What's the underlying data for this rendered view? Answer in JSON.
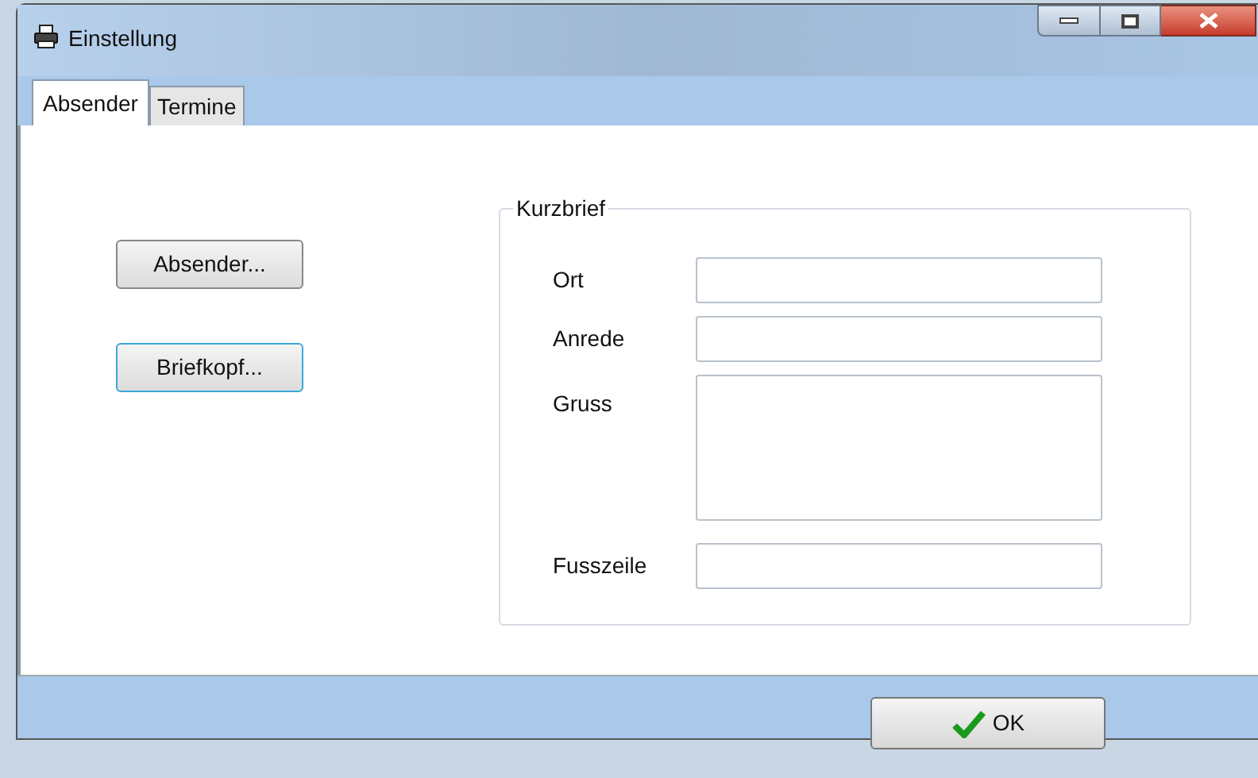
{
  "window": {
    "title": "Einstellung"
  },
  "tabs": [
    {
      "label": "Absender",
      "selected": true
    },
    {
      "label": "Termine",
      "selected": false
    }
  ],
  "buttons": [
    {
      "label": "Absender...",
      "focused": false
    },
    {
      "label": "Briefkopf...",
      "focused": true
    }
  ],
  "group": {
    "title": "Kurzbrief",
    "fields": [
      {
        "label": "Ort",
        "kind": "line"
      },
      {
        "label": "Anrede",
        "kind": "line"
      },
      {
        "label": "Gruss",
        "kind": "multiline"
      },
      {
        "label": "Fusszeile",
        "kind": "line"
      }
    ]
  },
  "ok_button": {
    "label": "OK"
  }
}
